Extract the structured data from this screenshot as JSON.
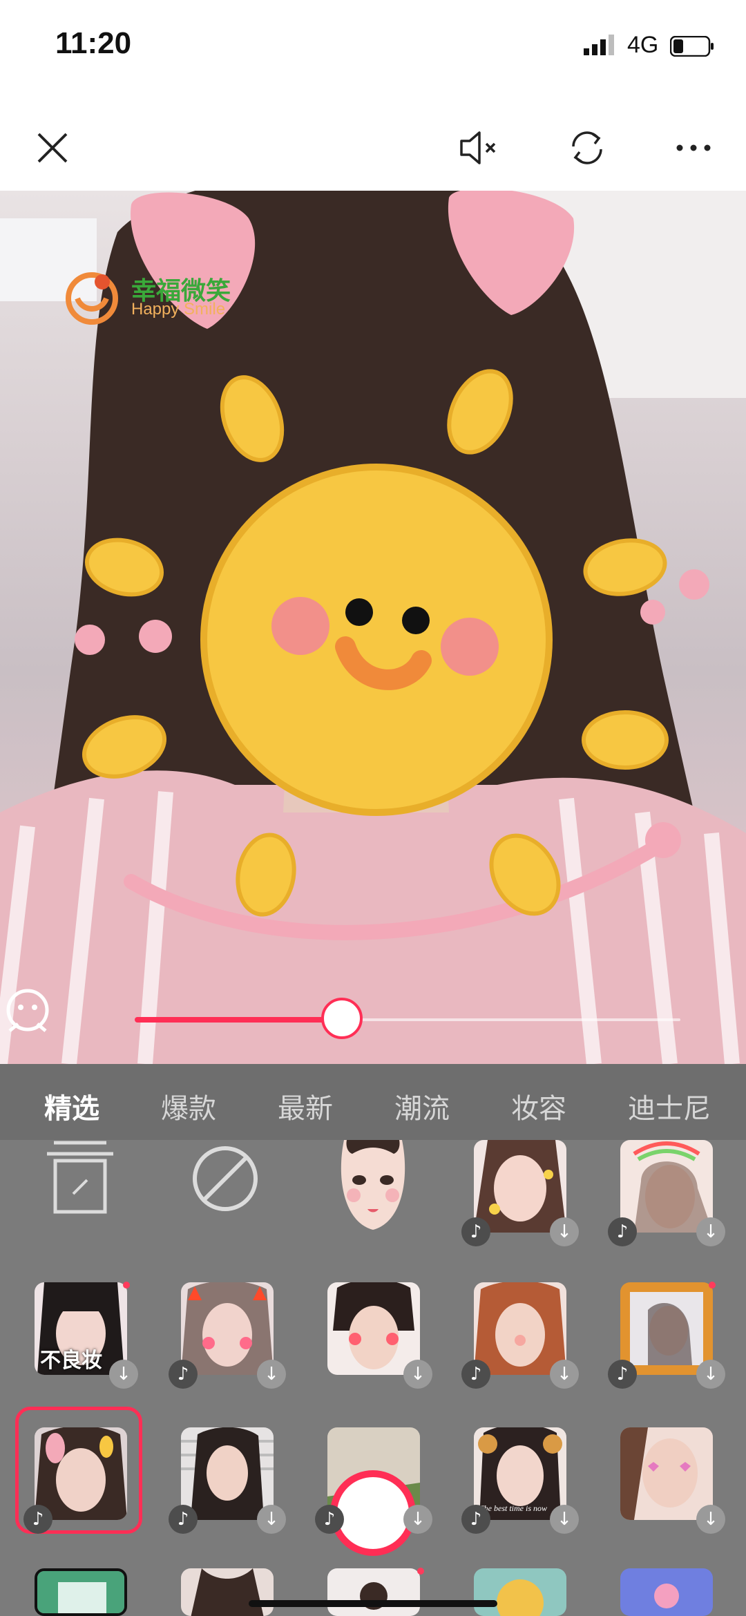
{
  "status": {
    "time": "11:20",
    "network": "4G"
  },
  "toolbar": {
    "close_icon": "close-icon",
    "mute_icon": "speaker-muted-icon",
    "switch_icon": "camera-switch-icon",
    "more_icon": "more-icon"
  },
  "overlay": {
    "brand_cn": "幸福微笑",
    "brand_en": "Happy Smile"
  },
  "beauty": {
    "slider_value": 0.38,
    "accent": "#ff2e55"
  },
  "tabs": [
    {
      "label": "精选",
      "active": true
    },
    {
      "label": "爆款",
      "active": false
    },
    {
      "label": "最新",
      "active": false
    },
    {
      "label": "潮流",
      "active": false
    },
    {
      "label": "妆容",
      "active": false
    },
    {
      "label": "迪士尼",
      "active": false
    }
  ],
  "effects": {
    "row1": [
      "clear-effects-icon",
      "no-effect-icon",
      "cartoon-face",
      "sticker-flowers",
      "sticker-rainbow"
    ],
    "row2_label": "不良妆",
    "row3_caption": "The best time is now"
  }
}
